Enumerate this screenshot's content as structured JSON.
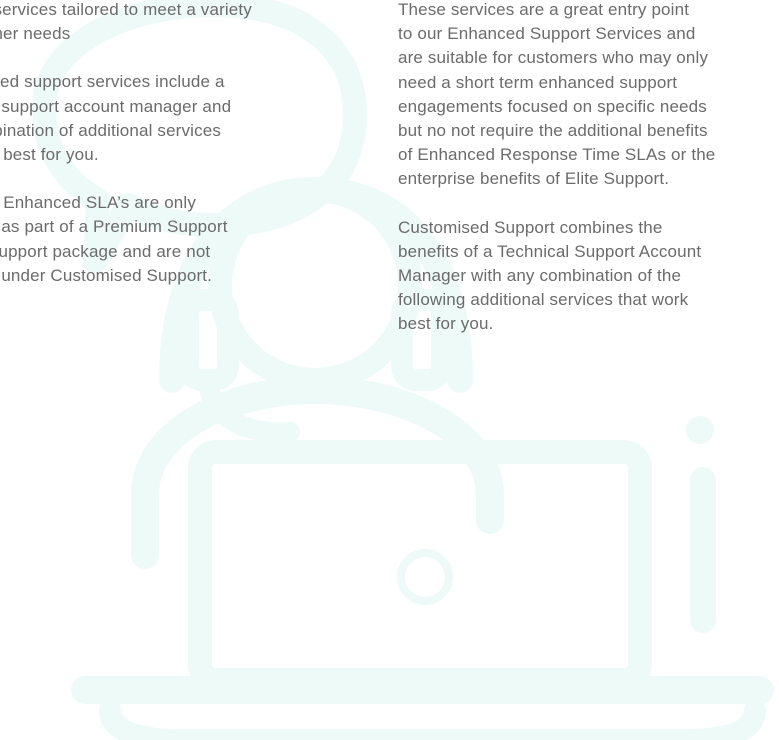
{
  "left_column": {
    "paragraphs": [
      "Support services tailored to meet a variety\nof customer needs",
      "Customised support services include a\ntechnical support account manager and\nany combination of additional services\nthat work best for you.",
      "Note that Enhanced SLA’s are only\navailable as part of a Premium Support\nor Elite Support package and are not\navailable under Customised Support."
    ]
  },
  "right_column": {
    "paragraphs": [
      "These services are a great entry point\nto our Enhanced Support Services and\nare suitable for customers who may only\nneed a short term enhanced support\nengagements focused on specific needs\nbut no not require the additional benefits\nof Enhanced Response Time SLAs or the\nenterprise benefits of Elite Support.",
      "Customised Support combines the\nbenefits of a Technical Support Account\nManager with any combination of the\nfollowing additional services that work\nbest for you."
    ]
  },
  "illustration": {
    "icon": "support-agent-laptop-icon",
    "color": "#eefaf8"
  }
}
